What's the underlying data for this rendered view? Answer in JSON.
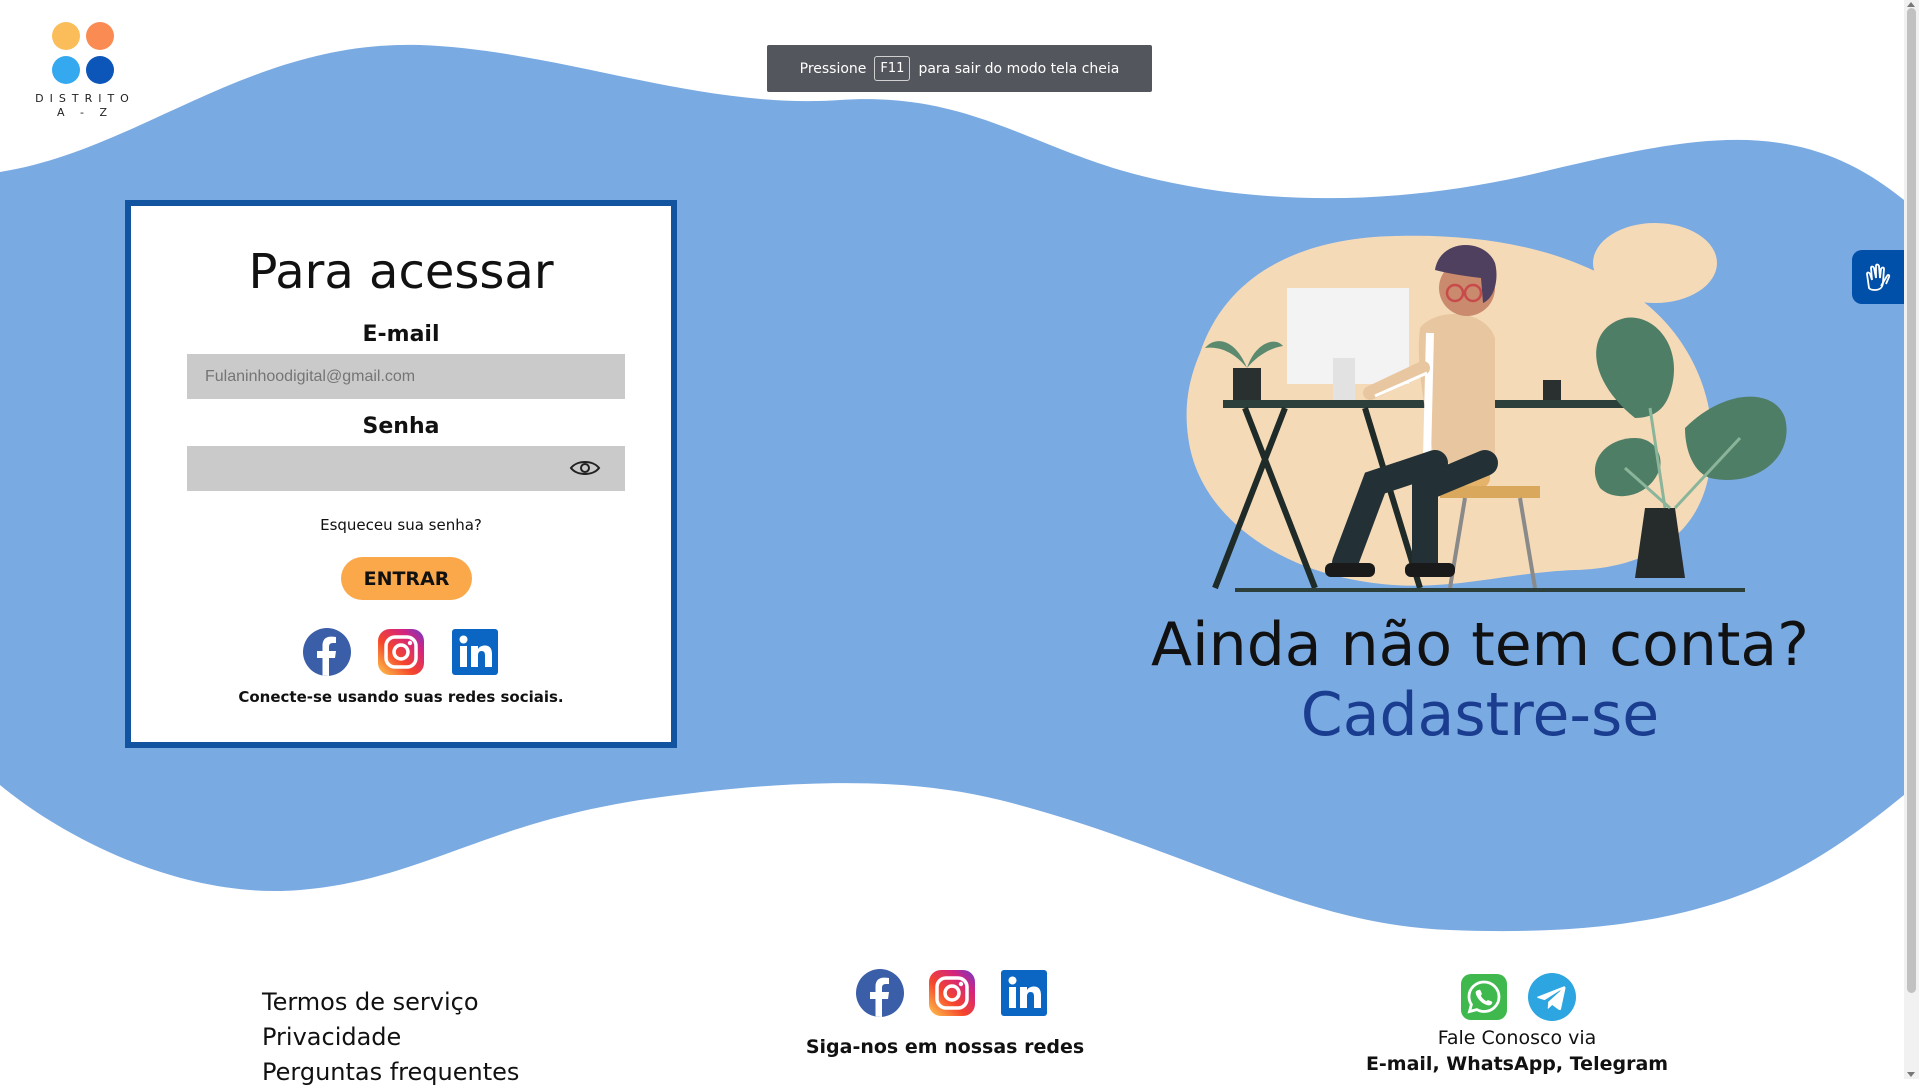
{
  "logo": {
    "line1": "DISTRITO",
    "line2": "A - Z",
    "dot_colors": [
      "#fbbd5a",
      "#f98b53",
      "#35a9f0",
      "#0b56b8"
    ]
  },
  "fullscreen_notice": {
    "before": "Pressione",
    "key": "F11",
    "after": "para sair do modo tela cheia"
  },
  "login": {
    "title": "Para acessar",
    "email_label": "E-mail",
    "email_placeholder": "Fulaninhoodigital@gmail.com",
    "password_label": "Senha",
    "password_icon": "eye-icon",
    "forgot_link": "Esqueceu sua senha?",
    "submit_label": "ENTRAR",
    "social_icons": [
      "facebook-icon",
      "instagram-icon",
      "linkedin-icon"
    ],
    "social_caption": "Conecte-se usando suas redes sociais."
  },
  "signup": {
    "question": "Ainda não tem conta?",
    "link": "Cadastre-se"
  },
  "accessibility": {
    "icon": "sign-language-hands-icon"
  },
  "footer": {
    "links": [
      "Termos de serviço",
      "Privacidade",
      "Perguntas frequentes"
    ],
    "social_icons": [
      "facebook-icon",
      "instagram-icon",
      "linkedin-icon"
    ],
    "social_caption": "Siga-nos em nossas redes",
    "contact_icons": [
      "whatsapp-icon",
      "telegram-icon"
    ],
    "contact_title": "Fale Conosco via",
    "contact_email": "E-mail",
    "contact_whatsapp": "WhatsApp",
    "contact_telegram": "Telegram",
    "separator": ","
  },
  "colors": {
    "wave_blue": "#7aaae2",
    "card_border": "#1254a0",
    "button_orange": "#fba84a",
    "cta_link_blue": "#1a3d8f",
    "accessibility_blue": "#004fa8"
  }
}
